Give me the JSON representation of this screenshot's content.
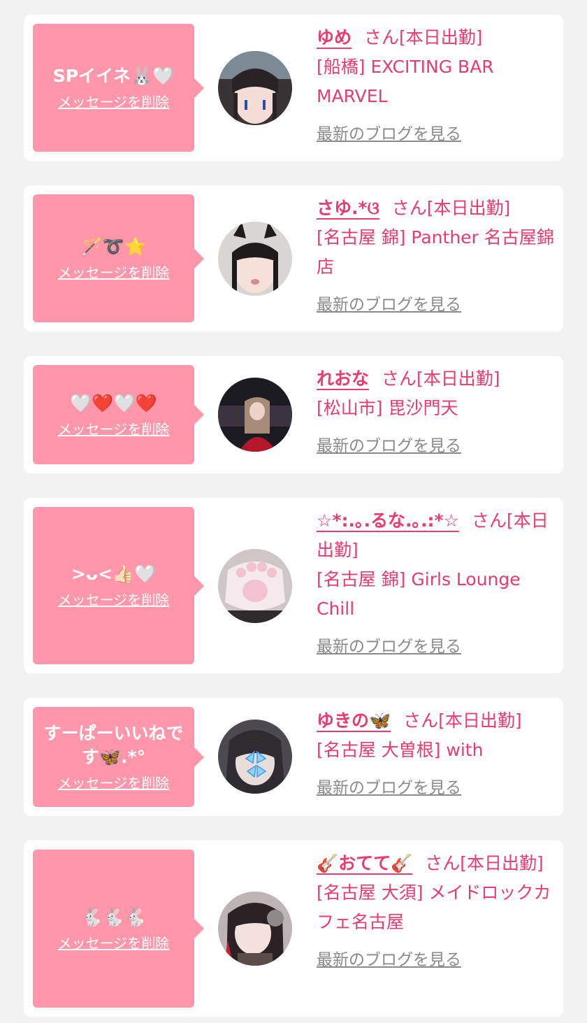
{
  "delete_label": "メッセージを削除",
  "blog_label": "最新のブログを見る",
  "colors": {
    "accent": "#e83c6e",
    "bubble": "#ff96a9",
    "link_gray": "#8a8a8a",
    "background": "#f2f2f2"
  },
  "items": [
    {
      "message": "SPイイネ🐰🤍",
      "name": "ゆめ",
      "suffix": "さん[本日出勤]",
      "shop": "[船橋] EXCITING BAR MARVEL"
    },
    {
      "message": "🪄➰⭐",
      "name": "さゆ.*ଓ",
      "suffix": "さん[本日出勤]",
      "shop": "[名古屋 錦] Panther 名古屋錦店"
    },
    {
      "message": "🤍❤️🤍❤️",
      "name": "れおな",
      "suffix": "さん[本日出勤]",
      "shop": "[松山市] 毘沙門天"
    },
    {
      "message": ">ᴗ<👍🏻🤍",
      "name": "☆*:.｡.るな.｡.:*☆",
      "suffix": "さん[本日出勤]",
      "shop": "[名古屋 錦] Girls Lounge Chill"
    },
    {
      "message": "すーぱーいいねです🦋.*°",
      "name": "ゆきの🦋",
      "suffix": "さん[本日出勤]",
      "shop": "[名古屋 大曽根] with"
    },
    {
      "message": "🐇🐇🐇",
      "name": "🎸おてて🎸",
      "suffix": "さん[本日出勤]",
      "shop": "[名古屋 大須] メイドロックカフェ名古屋"
    }
  ]
}
